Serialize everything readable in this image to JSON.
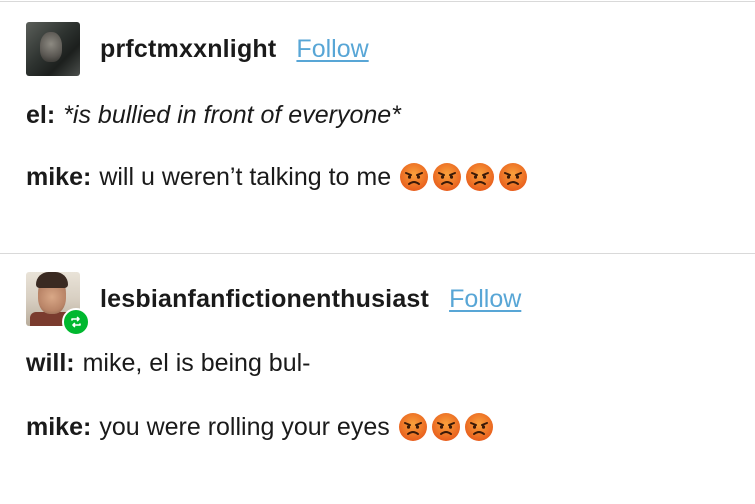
{
  "posts": [
    {
      "username": "prfctmxxnlight",
      "follow_label": "Follow",
      "lines": [
        {
          "speaker": "el:",
          "text": "*is bullied in front of everyone*",
          "italic": true,
          "emoji_count": 0
        },
        {
          "speaker": "mike:",
          "text": "will u weren’t talking to me",
          "italic": false,
          "emoji_count": 4
        }
      ]
    },
    {
      "username": "lesbianfanfictionenthusiast",
      "follow_label": "Follow",
      "reblogged": true,
      "lines": [
        {
          "speaker": "will:",
          "text": "mike, el is being bul-",
          "italic": false,
          "emoji_count": 0
        },
        {
          "speaker": "mike:",
          "text": "you were rolling your eyes",
          "italic": false,
          "emoji_count": 3
        }
      ]
    }
  ],
  "icons": {
    "emoji": "angry-face-icon",
    "badge": "reblog-icon"
  },
  "colors": {
    "follow_link": "#58a6d6",
    "reblog_badge": "#00b82f",
    "emoji": "#f0862c",
    "divider": "#d9d9d9"
  }
}
